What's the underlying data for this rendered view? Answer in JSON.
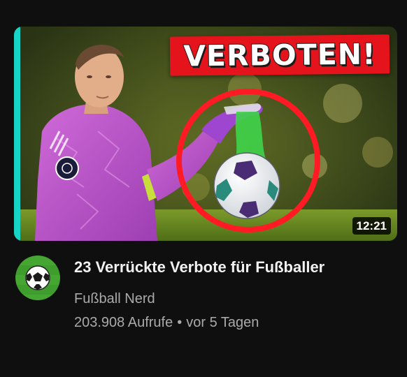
{
  "video": {
    "thumbnail": {
      "headline": "VERBOTEN!",
      "duration": "12:21",
      "accent_color": "#16d4c6",
      "badge_color": "#e5141c",
      "circle_color": "#ff1a24"
    },
    "title": "23 Verrückte Verbote für Fußballer",
    "channel": "Fußball Nerd",
    "views": "203.908 Aufrufe",
    "separator": "•",
    "published": "vor 5 Tagen",
    "avatar_icon": "soccer-ball-icon"
  }
}
